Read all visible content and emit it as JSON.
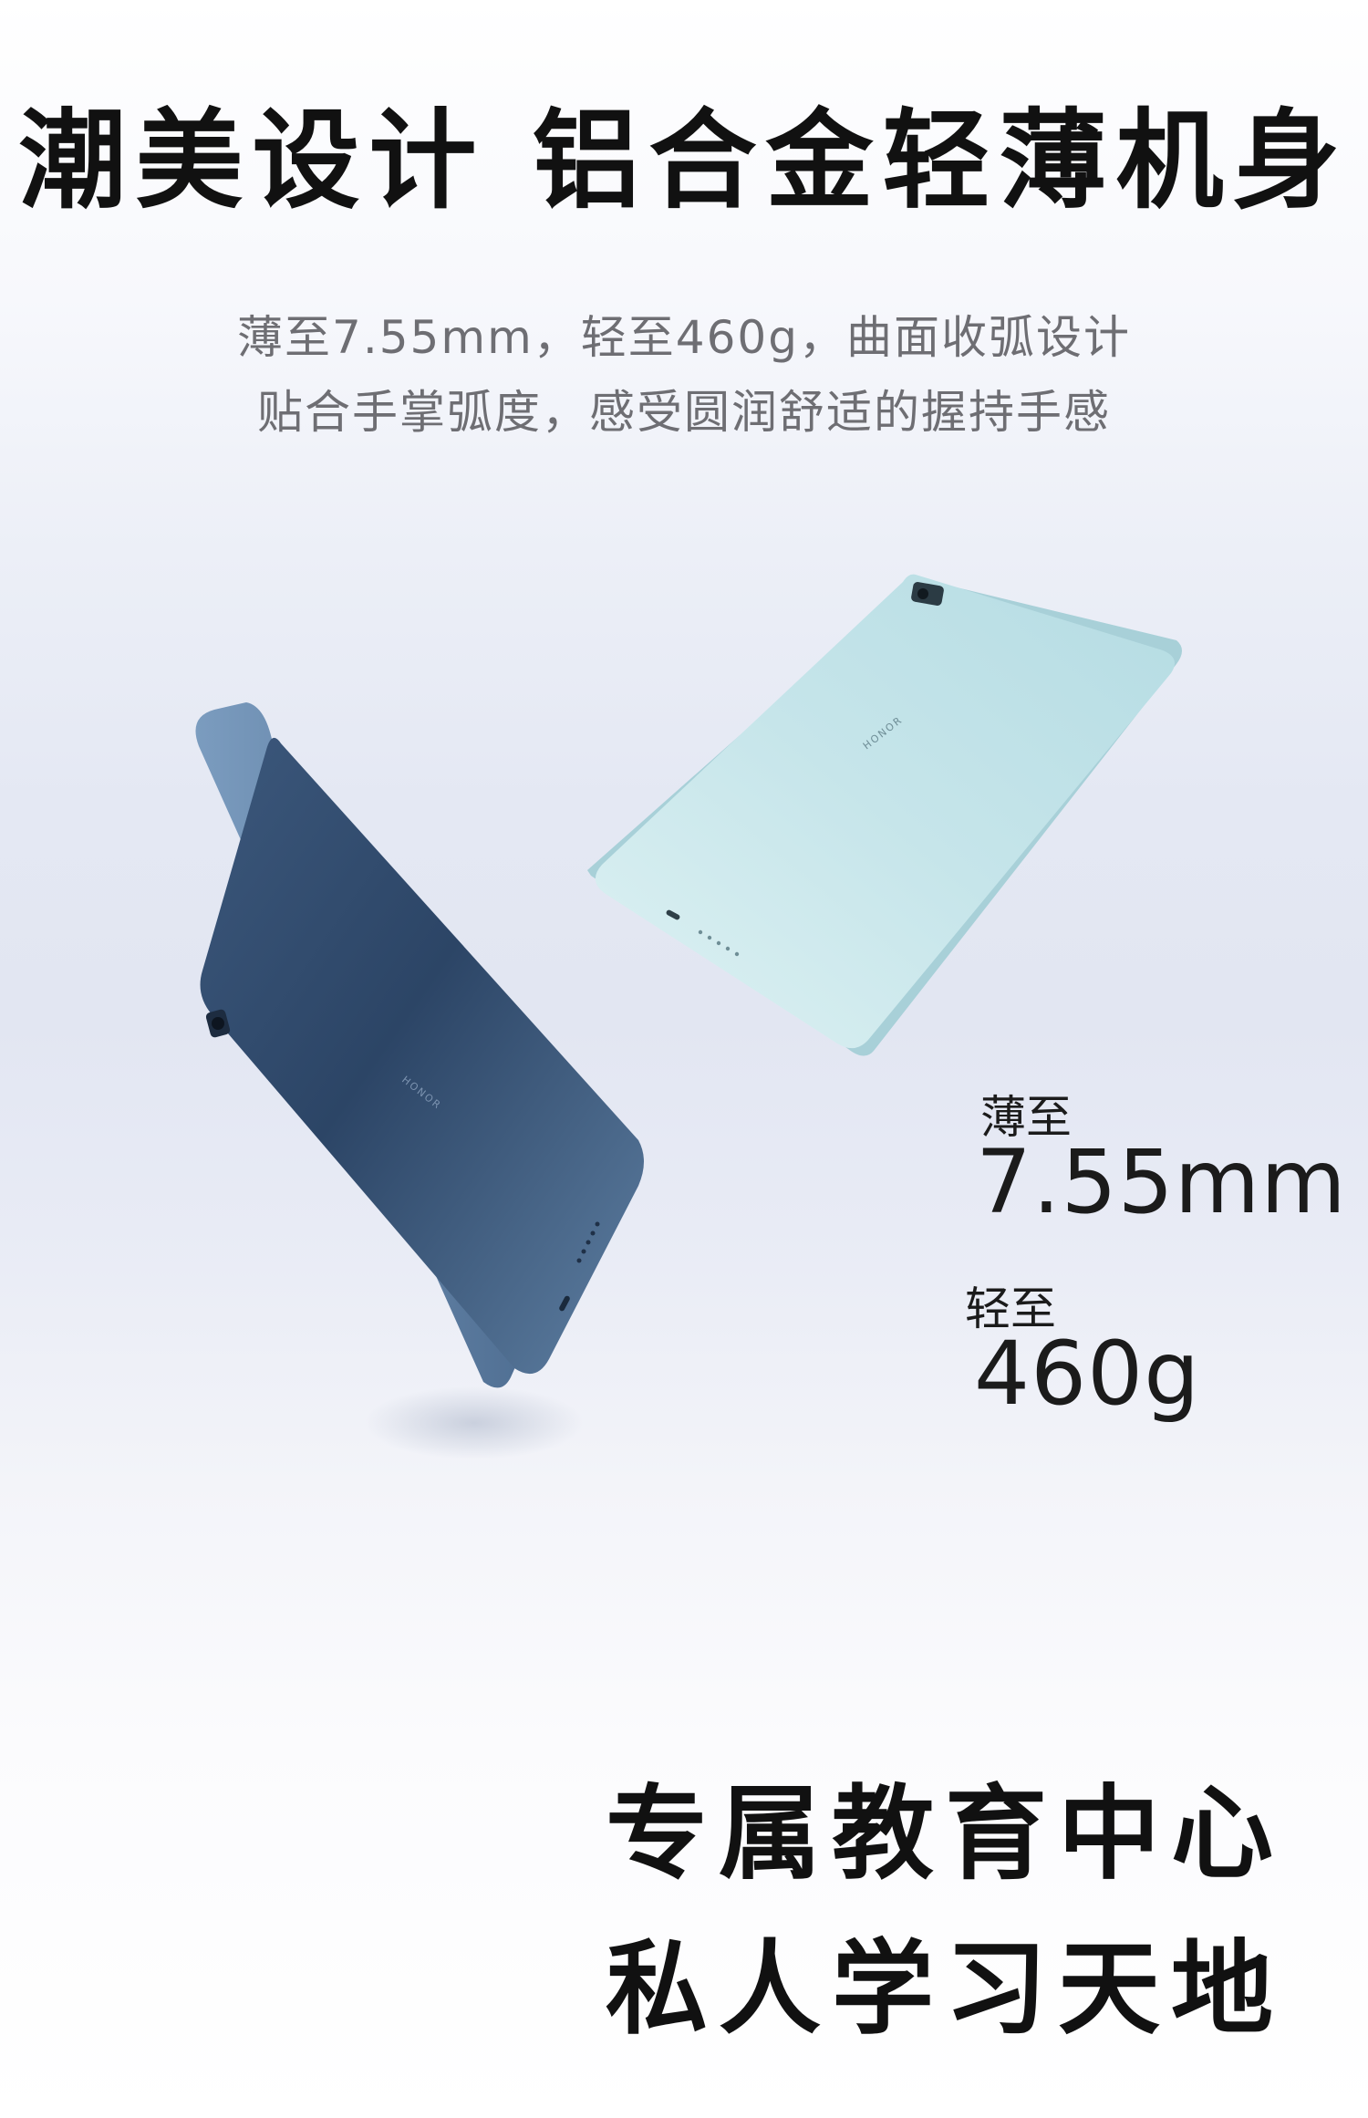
{
  "headline": "潮美设计 铝合金轻薄机身",
  "subtitle": {
    "line1": "薄至7.55mm，轻至460g，曲面收弧设计",
    "line2": "贴合手掌弧度，感受圆润舒适的握持手感"
  },
  "specs": {
    "thickness": {
      "label": "薄至",
      "value": "7.55mm"
    },
    "weight": {
      "label": "轻至",
      "value": "460g"
    }
  },
  "closing": {
    "line1": "专属教育中心",
    "line2": "私人学习天地"
  },
  "products": {
    "brand_mark": "HONOR",
    "dark_tablet_color": "#2f4868",
    "light_tablet_color": "#cfe9ec"
  }
}
